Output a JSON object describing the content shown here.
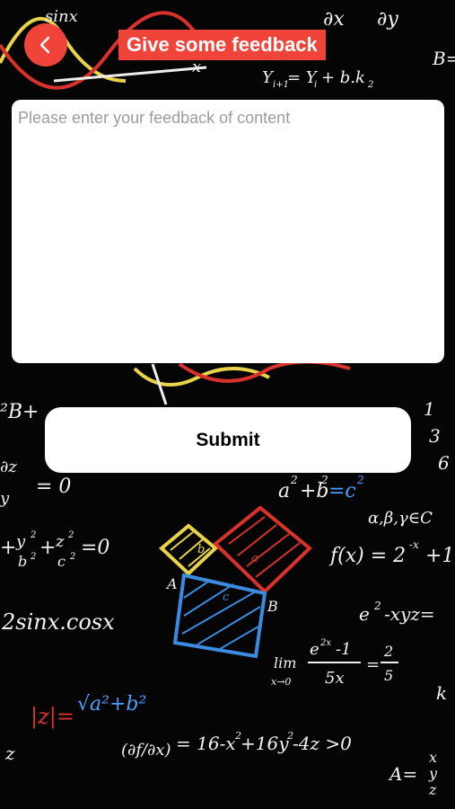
{
  "header": {
    "title": "Give some feedback",
    "back_icon": "chevron-left-icon",
    "accent_color": "#f0443a"
  },
  "feedback": {
    "value": "",
    "placeholder": "Please enter your feedback of content"
  },
  "actions": {
    "submit_label": "Submit"
  },
  "background": {
    "formulas": [
      "sinx",
      "∂x",
      "∂y",
      "Y",
      "i+1",
      "= Y",
      "i",
      "+ b.k",
      "2",
      "B=",
      "x",
      "²B+",
      "∂z",
      "y",
      "= 0",
      "a",
      "2",
      "+b",
      "2",
      "=c",
      "2",
      "α,β,γ∈C",
      "+",
      "y",
      "2",
      "b",
      "2",
      "+",
      "z",
      "2",
      "c",
      "2",
      "=0",
      "f(x) = 2",
      "-x",
      "+1,",
      "A",
      "B",
      "c",
      "b",
      "a",
      "2sinx.cosx",
      "e",
      "2",
      "-xyz=",
      "lim",
      "x→0",
      "e",
      "2x",
      "-1",
      "5x",
      "=",
      "2",
      "5",
      "|z|=",
      "√a²+b²",
      "z",
      "(∂f/∂x)",
      "= 16-x",
      "2",
      "+16y",
      "2",
      "-4z >0",
      "A=",
      "x",
      "y",
      "z",
      "1",
      "3",
      "6",
      "k"
    ]
  }
}
